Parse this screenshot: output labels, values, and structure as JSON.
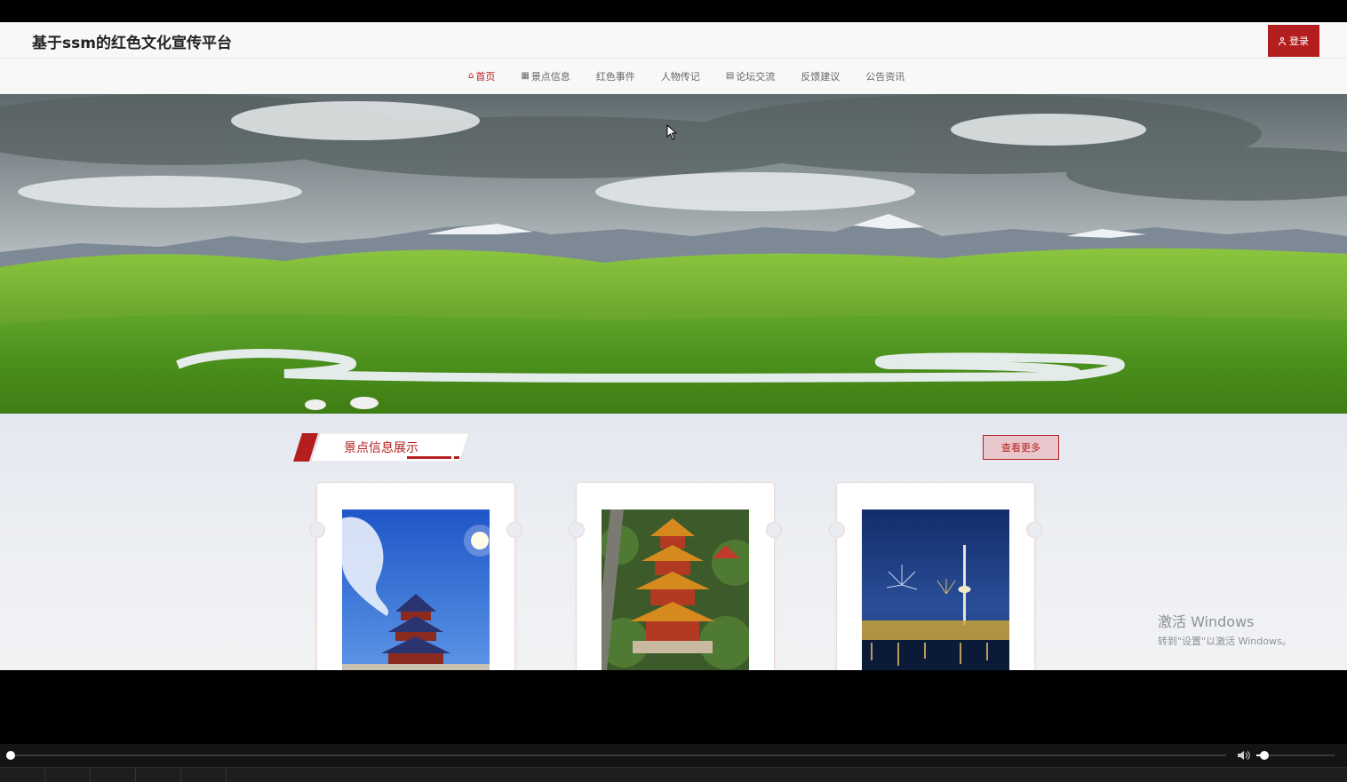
{
  "header": {
    "site_title": "基于ssm的红色文化宣传平台",
    "login_label": "登录"
  },
  "nav": {
    "items": [
      {
        "label": "首页",
        "icon": "home-icon",
        "active": true
      },
      {
        "label": "景点信息",
        "icon": "grid-icon",
        "active": false
      },
      {
        "label": "红色事件",
        "icon": "",
        "active": false
      },
      {
        "label": "人物传记",
        "icon": "",
        "active": false
      },
      {
        "label": "论坛交流",
        "icon": "list-icon",
        "active": false
      },
      {
        "label": "反馈建议",
        "icon": "",
        "active": false
      },
      {
        "label": "公告资讯",
        "icon": "",
        "active": false
      }
    ]
  },
  "section": {
    "title": "景点信息展示",
    "more_label": "查看更多"
  },
  "watermark": {
    "line1": "激活 Windows",
    "line2": "转到\"设置\"以激活 Windows。"
  },
  "colors": {
    "accent": "#b51e1e",
    "header_bg": "#f8f8f8"
  }
}
